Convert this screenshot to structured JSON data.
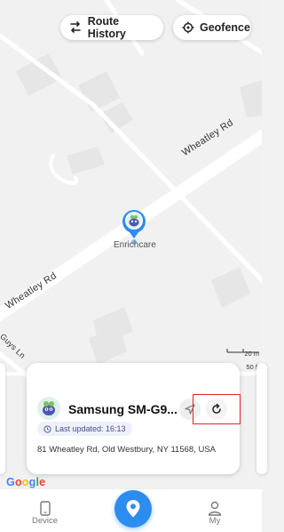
{
  "header": {
    "route_history_label": "Route History",
    "geofence_label": "Geofence"
  },
  "map": {
    "streets": [
      "Wheatley Rd",
      "Wheatley Rd",
      "Guys Ln"
    ],
    "marker_label": "Enrichcare",
    "scale": {
      "metric": "20 m",
      "imperial": "50 ft"
    },
    "attribution": "Google"
  },
  "device_card": {
    "device_name": "Samsung SM-G9...",
    "last_updated": "Last updated: 16:13",
    "address": "81 Wheatley Rd, Old Westbury, NY 11568, USA"
  },
  "tabbar": {
    "device_label": "Device",
    "my_label": "My"
  },
  "colors": {
    "accent": "#2d8cf0",
    "highlight": "#e0252b",
    "google": [
      "#4285F4",
      "#EA4335",
      "#FBBC05",
      "#4285F4",
      "#34A853",
      "#EA4335"
    ]
  }
}
